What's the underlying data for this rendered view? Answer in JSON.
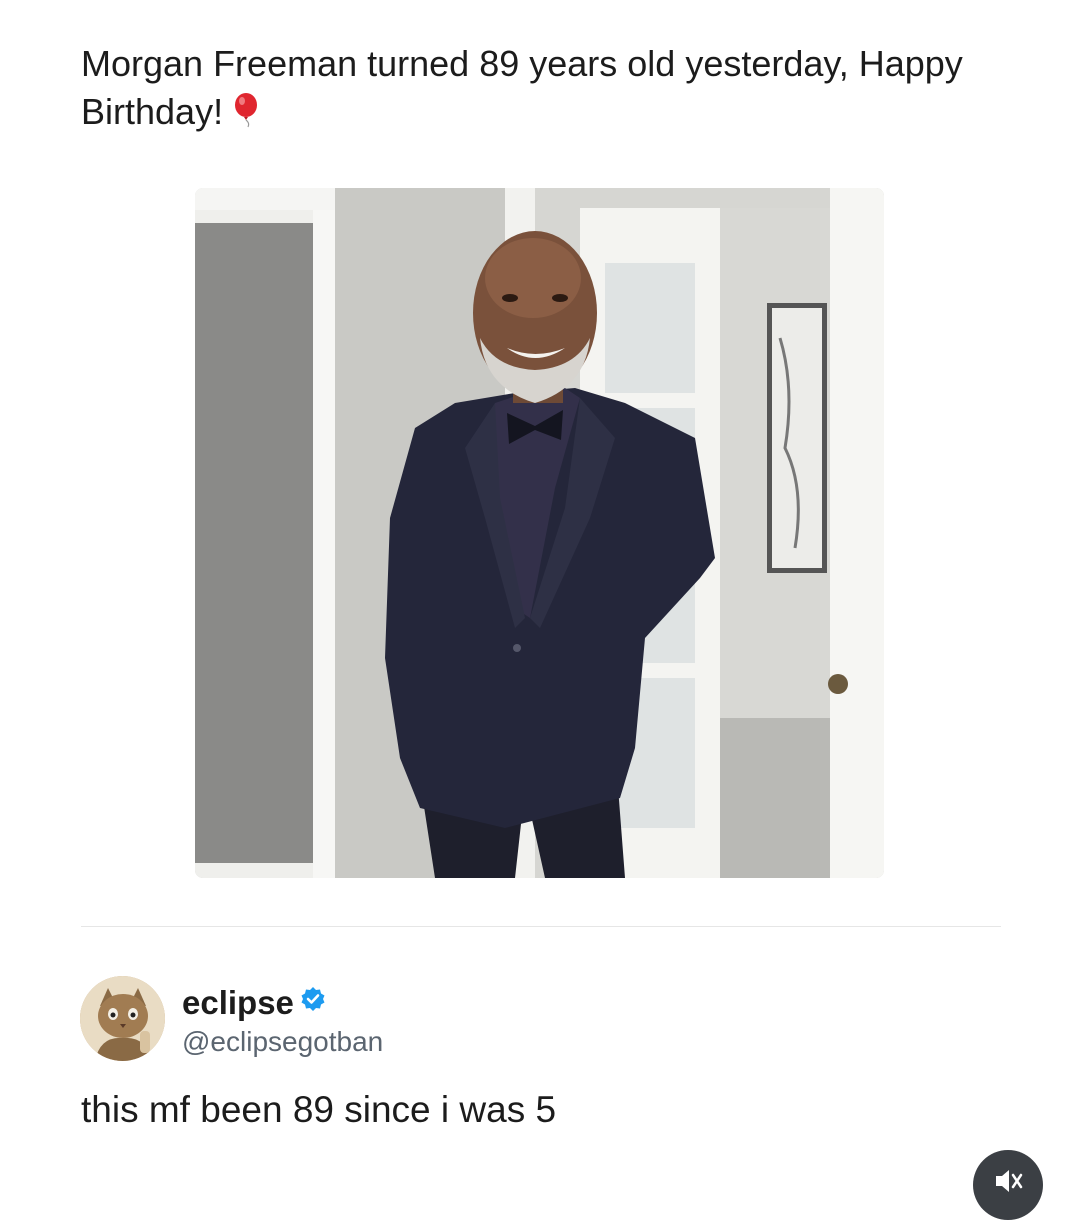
{
  "post": {
    "text": "Morgan Freeman turned 89 years old yesterday, Happy Birthday!",
    "emoji_icon": "red-balloon-icon"
  },
  "tweet": {
    "author_name": "eclipse",
    "author_handle": "@eclipsegotban",
    "verified": true,
    "text": "this mf been 89 since i was 5"
  },
  "controls": {
    "mute_icon": "speaker-muted-icon"
  },
  "colors": {
    "verified_blue": "#1d9bf0",
    "balloon_red": "#e0262f",
    "mute_button_bg": "#3b3f44"
  }
}
